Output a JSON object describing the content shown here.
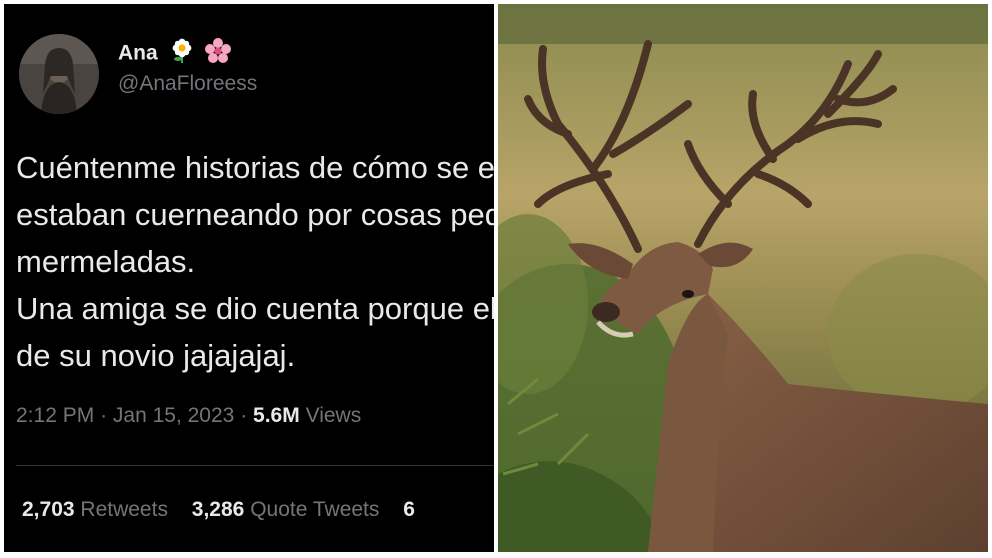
{
  "tweet": {
    "display_name": "Ana",
    "emojis": [
      "daisy-emoji",
      "cherry-blossom-emoji"
    ],
    "handle": "@AnaFloreess",
    "text_lines": [
      "Cuéntenme historias de cómo se enteraron que los",
      "estaban cuerneando por cosas pequeñas, como",
      "mermeladas.",
      "Una amiga se dio cuenta porque el perro",
      "de su novio jajajajaj."
    ],
    "time": "2:12 PM",
    "separator": "·",
    "date": "Jan 15, 2023",
    "views_count": "5.6M",
    "views_label": "Views",
    "stats": [
      {
        "count": "2,703",
        "label": "Retweets"
      },
      {
        "count": "3,286",
        "label": "Quote Tweets"
      },
      {
        "count": "6",
        "label": ""
      }
    ]
  },
  "photo": {
    "subject": "deer-stag"
  },
  "colors": {
    "tweet_background": "#000000",
    "primary_text": "#e7e9ea",
    "secondary_text": "#71767b",
    "divider": "#2f3336"
  }
}
